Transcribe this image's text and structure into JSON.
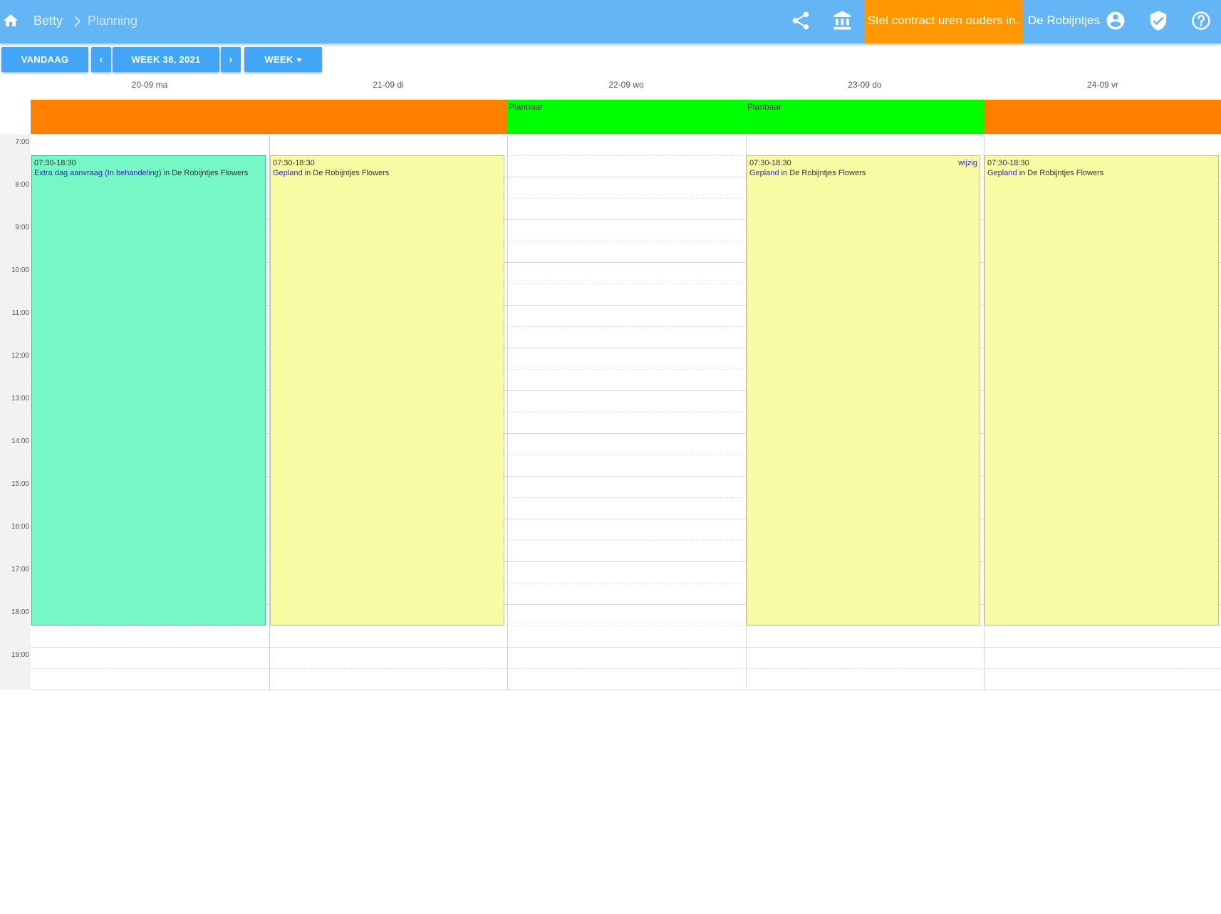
{
  "header": {
    "breadcrumb_user": "Betty",
    "breadcrumb_page": "Planning",
    "contract_button": "Stel contract uren ouders in.",
    "organization": "De Robijntjes",
    "icons": [
      "home-icon",
      "share-icon",
      "bank-icon",
      "account-icon",
      "shield-check-icon",
      "help-icon"
    ]
  },
  "toolbar": {
    "today_label": "VANDAAG",
    "prev_label": "‹",
    "week_label": "WEEK 38, 2021",
    "next_label": "›",
    "view_label": "WEEK"
  },
  "days": [
    {
      "label": "20-09 ma",
      "allday": "",
      "allday_color": "#ff8000"
    },
    {
      "label": "21-09 di",
      "allday": "",
      "allday_color": "#ff8000"
    },
    {
      "label": "22-09 wo",
      "allday": "Planbaar",
      "allday_color": "#00ff00"
    },
    {
      "label": "23-09 do",
      "allday": "Planbaar",
      "allday_color": "#00ff00"
    },
    {
      "label": "24-09 vr",
      "allday": "",
      "allday_color": "#ff8000"
    }
  ],
  "hours": [
    "7:00",
    "8:00",
    "9:00",
    "10:00",
    "11:00",
    "12:00",
    "13:00",
    "14:00",
    "15:00",
    "16:00",
    "17:00",
    "18:00",
    "19:00"
  ],
  "events": [
    {
      "time": "07:30-18:30",
      "status": "Extra dag aanvraag (In behandeling)",
      "location": " in De Robijntjes Flowers",
      "edit": ""
    },
    {
      "time": "07:30-18:30",
      "status": "Gepland",
      "location": " in De Robijntjes Flowers",
      "edit": ""
    },
    {
      "time": "07:30-18:30",
      "status": "Gepland",
      "location": " in De Robijntjes Flowers",
      "edit": "wijzig"
    },
    {
      "time": "07:30-18:30",
      "status": "Gepland",
      "location": " in De Robijntjes Flowers",
      "edit": ""
    }
  ],
  "colors": {
    "topbar": "#64b5f6",
    "accent_button": "#42a5f5",
    "contract": "#ff9800",
    "request_event": "#77f7c5",
    "planned_event": "#f8fba3",
    "available": "#00ff00",
    "unavailable": "#ff8000"
  }
}
